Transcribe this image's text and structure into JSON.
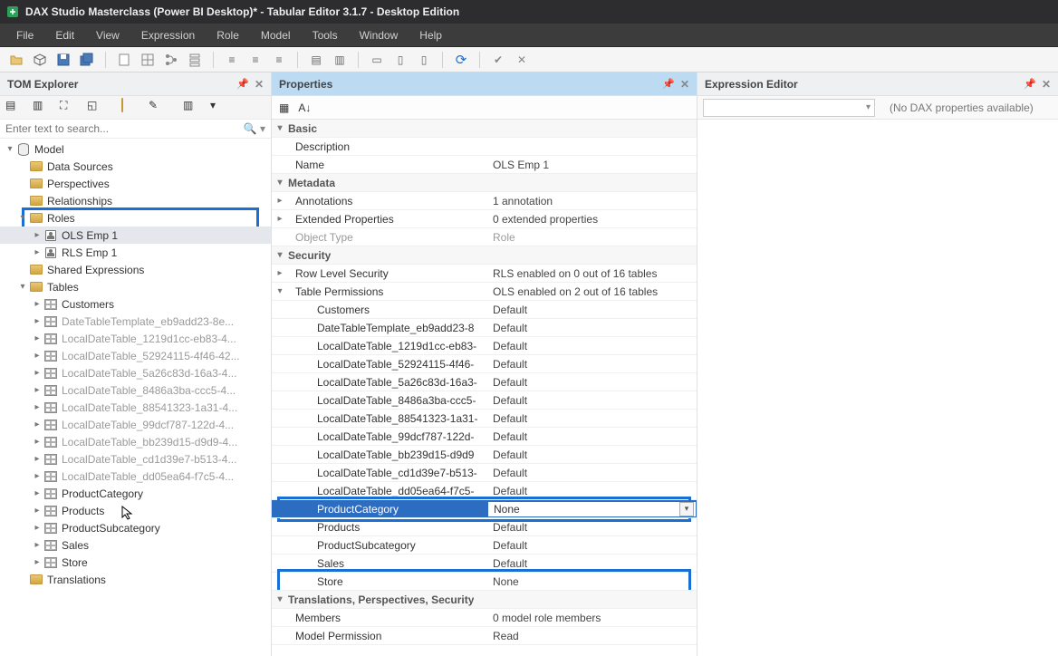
{
  "title": "DAX Studio Masterclass (Power BI Desktop)* - Tabular Editor 3.1.7 - Desktop Edition",
  "menu": {
    "file": "File",
    "edit": "Edit",
    "view": "View",
    "expression": "Expression",
    "role": "Role",
    "model": "Model",
    "tools": "Tools",
    "window": "Window",
    "help": "Help"
  },
  "tom": {
    "heading": "TOM Explorer",
    "search_placeholder": "Enter text to search...",
    "nodes": {
      "model": "Model",
      "data_sources": "Data Sources",
      "perspectives": "Perspectives",
      "relationships": "Relationships",
      "roles": "Roles",
      "ols_emp_1": "OLS Emp 1",
      "rls_emp_1": "RLS Emp 1",
      "shared_expressions": "Shared Expressions",
      "tables": "Tables",
      "customers": "Customers",
      "dtt": "DateTableTemplate_eb9add23-8e...",
      "ldt1": "LocalDateTable_1219d1cc-eb83-4...",
      "ldt2": "LocalDateTable_52924115-4f46-42...",
      "ldt3": "LocalDateTable_5a26c83d-16a3-4...",
      "ldt4": "LocalDateTable_8486a3ba-ccc5-4...",
      "ldt5": "LocalDateTable_88541323-1a31-4...",
      "ldt6": "LocalDateTable_99dcf787-122d-4...",
      "ldt7": "LocalDateTable_bb239d15-d9d9-4...",
      "ldt8": "LocalDateTable_cd1d39e7-b513-4...",
      "ldt9": "LocalDateTable_dd05ea64-f7c5-4...",
      "product_category": "ProductCategory",
      "products": "Products",
      "product_subcategory": "ProductSubcategory",
      "sales": "Sales",
      "store": "Store",
      "translations": "Translations"
    }
  },
  "props": {
    "heading": "Properties",
    "cats": {
      "basic": "Basic",
      "metadata": "Metadata",
      "security": "Security",
      "tps": "Translations, Perspectives, Security"
    },
    "rows": {
      "description_k": "Description",
      "description_v": "",
      "name_k": "Name",
      "name_v": "OLS Emp 1",
      "annotations_k": "Annotations",
      "annotations_v": "1 annotation",
      "extprops_k": "Extended Properties",
      "extprops_v": "0 extended properties",
      "objtype_k": "Object Type",
      "objtype_v": "Role",
      "rls_k": "Row Level Security",
      "rls_v": "RLS enabled on 0 out of 16 tables",
      "tperm_k": "Table Permissions",
      "tperm_v": "OLS enabled on 2 out of 16 tables",
      "customers_k": "Customers",
      "customers_v": "Default",
      "dtt_k": "DateTableTemplate_eb9add23-8",
      "dtt_v": "Default",
      "ldt1_k": "LocalDateTable_1219d1cc-eb83-",
      "ldt1_v": "Default",
      "ldt2_k": "LocalDateTable_52924115-4f46-",
      "ldt2_v": "Default",
      "ldt3_k": "LocalDateTable_5a26c83d-16a3-",
      "ldt3_v": "Default",
      "ldt4_k": "LocalDateTable_8486a3ba-ccc5-",
      "ldt4_v": "Default",
      "ldt5_k": "LocalDateTable_88541323-1a31-",
      "ldt5_v": "Default",
      "ldt6_k": "LocalDateTable_99dcf787-122d-",
      "ldt6_v": "Default",
      "ldt7_k": "LocalDateTable_bb239d15-d9d9",
      "ldt7_v": "Default",
      "ldt8_k": "LocalDateTable_cd1d39e7-b513-",
      "ldt8_v": "Default",
      "ldt9_k": "LocalDateTable_dd05ea64-f7c5-",
      "ldt9_v": "Default",
      "pc_k": "ProductCategory",
      "pc_v": "None",
      "prod_k": "Products",
      "prod_v": "Default",
      "psc_k": "ProductSubcategory",
      "psc_v": "Default",
      "sales_k": "Sales",
      "sales_v": "Default",
      "store_k": "Store",
      "store_v": "None",
      "members_k": "Members",
      "members_v": "0 model role members",
      "modelperm_k": "Model Permission",
      "modelperm_v": "Read"
    }
  },
  "expr": {
    "heading": "Expression Editor",
    "empty": "(No DAX properties available)"
  }
}
